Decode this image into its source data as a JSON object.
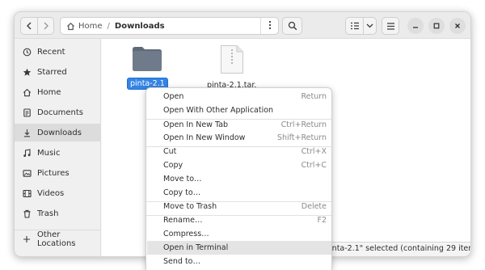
{
  "window": {
    "path": {
      "home": "Home",
      "current": "Downloads"
    },
    "icons": {
      "back": "chevron-left-icon",
      "forward": "chevron-right-icon",
      "home": "home-icon",
      "path_menu": "vertical-dots-icon",
      "search": "search-icon",
      "view": "list-view-icon",
      "view_options": "chevron-down-icon",
      "menu": "hamburger-menu-icon",
      "minimize": "minimize-icon",
      "maximize": "maximize-icon",
      "close": "close-icon"
    }
  },
  "sidebar": {
    "items": [
      {
        "label": "Recent",
        "icon": "clock-icon"
      },
      {
        "label": "Starred",
        "icon": "star-icon"
      },
      {
        "label": "Home",
        "icon": "home-icon"
      },
      {
        "label": "Documents",
        "icon": "document-icon"
      },
      {
        "label": "Downloads",
        "icon": "download-icon",
        "active": true
      },
      {
        "label": "Music",
        "icon": "music-note-icon"
      },
      {
        "label": "Pictures",
        "icon": "picture-icon"
      },
      {
        "label": "Videos",
        "icon": "film-icon"
      },
      {
        "label": "Trash",
        "icon": "trash-icon"
      }
    ],
    "other_locations": {
      "label": "Other Locations",
      "icon": "plus-icon"
    }
  },
  "files": [
    {
      "name": "pinta-2.1",
      "type": "folder",
      "selected": true
    },
    {
      "name": "pinta-2.1.tar.",
      "type": "archive",
      "selected": false
    }
  ],
  "status": {
    "text": "pinta-2.1\" selected  (containing 29 items)"
  },
  "context_menu": {
    "items": [
      {
        "label": "Open",
        "accel": "Return"
      },
      {
        "label": "Open With Other Application",
        "accel": ""
      },
      {
        "label": "Open In New Tab",
        "accel": "Ctrl+Return"
      },
      {
        "label": "Open In New Window",
        "accel": "Shift+Return"
      },
      {
        "label": "Cut",
        "accel": "Ctrl+X"
      },
      {
        "label": "Copy",
        "accel": "Ctrl+C"
      },
      {
        "label": "Move to…",
        "accel": ""
      },
      {
        "label": "Copy to…",
        "accel": ""
      },
      {
        "label": "Move to Trash",
        "accel": "Delete"
      },
      {
        "label": "Rename…",
        "accel": "F2"
      },
      {
        "label": "Compress…",
        "accel": ""
      },
      {
        "label": "Open in Terminal",
        "accel": "",
        "highlighted": true
      },
      {
        "label": "Send to…",
        "accel": ""
      }
    ]
  },
  "colors": {
    "accent": "#3584e4",
    "folder": "#6f7b8a",
    "sidebar_active": "#dcdcdc"
  }
}
